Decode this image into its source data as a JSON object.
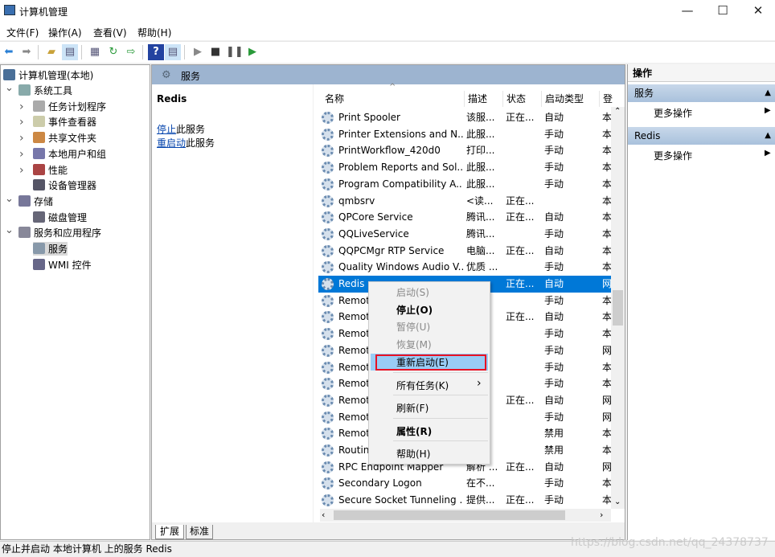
{
  "window": {
    "title": "计算机管理",
    "minimize": "—",
    "maximize": "☐",
    "close": "✕"
  },
  "menubar": [
    "文件(F)",
    "操作(A)",
    "查看(V)",
    "帮助(H)"
  ],
  "toolbar": [
    "back-icon",
    "forward-icon",
    "up-folder-icon",
    "show-hide-tree-icon",
    "properties-icon",
    "refresh-icon",
    "export-icon",
    "help-icon",
    "show-action-pane-icon",
    "play-icon",
    "stop-icon",
    "pause-icon",
    "resume-icon"
  ],
  "tree": {
    "root": "计算机管理(本地)",
    "items": [
      {
        "label": "系统工具",
        "level": 1,
        "expanded": true
      },
      {
        "label": "任务计划程序",
        "level": 2
      },
      {
        "label": "事件查看器",
        "level": 2
      },
      {
        "label": "共享文件夹",
        "level": 2
      },
      {
        "label": "本地用户和组",
        "level": 2
      },
      {
        "label": "性能",
        "level": 2
      },
      {
        "label": "设备管理器",
        "level": 2,
        "leaf": true
      },
      {
        "label": "存储",
        "level": 1,
        "expanded": true
      },
      {
        "label": "磁盘管理",
        "level": 2,
        "leaf": true
      },
      {
        "label": "服务和应用程序",
        "level": 1,
        "expanded": true
      },
      {
        "label": "服务",
        "level": 2,
        "leaf": true,
        "selected": true
      },
      {
        "label": "WMI 控件",
        "level": 2,
        "leaf": true
      }
    ]
  },
  "services_panel": {
    "title": "服务",
    "selected_name": "Redis",
    "stop_link": "停止",
    "stop_suffix": "此服务",
    "restart_link": "重启动",
    "restart_suffix": "此服务"
  },
  "columns": [
    "名称",
    "描述",
    "状态",
    "启动类型",
    "登"
  ],
  "rows": [
    [
      "Print Spooler",
      "该服...",
      "正在...",
      "自动",
      "本"
    ],
    [
      "Printer Extensions and N...",
      "此服...",
      "",
      "手动",
      "本"
    ],
    [
      "PrintWorkflow_420d0",
      "打印...",
      "",
      "手动",
      "本"
    ],
    [
      "Problem Reports and Sol...",
      "此服...",
      "",
      "手动",
      "本"
    ],
    [
      "Program Compatibility A...",
      "此服...",
      "",
      "手动",
      "本"
    ],
    [
      "qmbsrv",
      "<读...",
      "正在...",
      "",
      "本"
    ],
    [
      "QPCore Service",
      "腾讯...",
      "正在...",
      "自动",
      "本"
    ],
    [
      "QQLiveService",
      "腾讯...",
      "",
      "手动",
      "本"
    ],
    [
      "QQPCMgr RTP Service",
      "电脑...",
      "正在...",
      "自动",
      "本"
    ],
    [
      "Quality Windows Audio V...",
      "优质 ...",
      "",
      "手动",
      "本"
    ],
    [
      "Redis",
      "",
      "正在...",
      "自动",
      "网"
    ],
    [
      "Remote",
      "...",
      "",
      "手动",
      "本"
    ],
    [
      "Remote",
      "...",
      "正在...",
      "自动",
      "本"
    ],
    [
      "Remote",
      "...",
      "",
      "手动",
      "本"
    ],
    [
      "Remote",
      "...",
      "",
      "手动",
      "网"
    ],
    [
      "Remote",
      "...",
      "",
      "手动",
      "本"
    ],
    [
      "Remote",
      "...",
      "",
      "手动",
      "本"
    ],
    [
      "Remote",
      "...",
      "正在...",
      "自动",
      "网"
    ],
    [
      "Remote",
      "...",
      "",
      "手动",
      "网"
    ],
    [
      "Remote",
      "...",
      "",
      "禁用",
      "本"
    ],
    [
      "Routing",
      "...",
      "",
      "禁用",
      "本"
    ],
    [
      "RPC Endpoint Mapper",
      "解析 ...",
      "正在...",
      "自动",
      "网"
    ],
    [
      "Secondary Logon",
      "在不...",
      "",
      "手动",
      "本"
    ],
    [
      "Secure Socket Tunneling ...",
      "提供...",
      "正在...",
      "手动",
      "本"
    ]
  ],
  "selected_row": 10,
  "context_menu": [
    {
      "label": "启动(S)",
      "state": "disabled"
    },
    {
      "label": "停止(O)",
      "state": "bold"
    },
    {
      "label": "暂停(U)",
      "state": "disabled"
    },
    {
      "label": "恢复(M)",
      "state": "disabled"
    },
    {
      "label": "重新启动(E)",
      "state": "highlighted"
    },
    {
      "label": "所有任务(K)",
      "state": "submenu"
    },
    {
      "label": "刷新(F)",
      "state": "normal"
    },
    {
      "label": "属性(R)",
      "state": "bold"
    },
    {
      "label": "帮助(H)",
      "state": "normal"
    }
  ],
  "tabs": [
    "扩展",
    "标准"
  ],
  "actions": {
    "title": "操作",
    "groups": [
      {
        "label": "服务",
        "item": "更多操作"
      },
      {
        "label": "Redis",
        "item": "更多操作"
      }
    ]
  },
  "status": "停止并启动 本地计算机 上的服务 Redis",
  "watermark": "https://blog.csdn.net/qq_24378737",
  "colors": {
    "selection": "#0078d7",
    "menu_highlight": "#99ccf5",
    "highlight_border": "#e81123",
    "panel_header": "#9db4d0"
  }
}
